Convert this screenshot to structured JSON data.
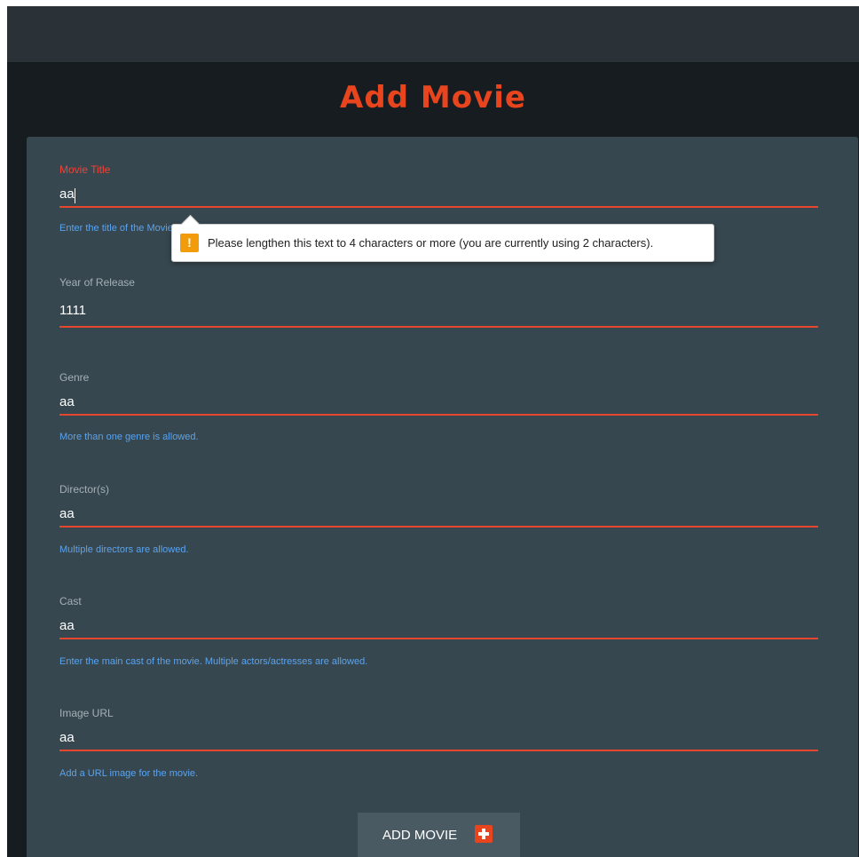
{
  "page": {
    "title": "Add Movie"
  },
  "form": {
    "fields": [
      {
        "label": "Movie Title",
        "value": "aa",
        "help": "Enter the title of the Movie."
      },
      {
        "label": "Year of Release",
        "value": "1111",
        "help": ""
      },
      {
        "label": "Genre",
        "value": "aa",
        "help": "More than one genre is allowed."
      },
      {
        "label": "Director(s)",
        "value": "aa",
        "help": "Multiple directors are allowed."
      },
      {
        "label": "Cast",
        "value": "aa",
        "help": "Enter the main cast of the movie. Multiple actors/actresses are allowed."
      },
      {
        "label": "Image URL",
        "value": "aa",
        "help": "Add a URL image for the movie."
      }
    ],
    "submit_label": "ADD MOVIE"
  },
  "tooltip": {
    "icon": "warning-icon",
    "icon_glyph": "!",
    "message": "Please lengthen this text to 4 characters or more (you are currently using 2 characters)."
  },
  "colors": {
    "accent": "#e8451f",
    "help_text": "#5aa3ef",
    "card_bg": "#37474f",
    "warning": "#f29c0c"
  }
}
